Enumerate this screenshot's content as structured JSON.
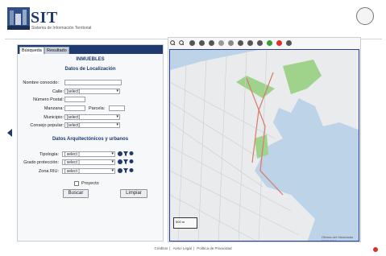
{
  "header": {
    "brand": "SIT",
    "subtitle": "Sistema de Información Territorial"
  },
  "tabs": [
    {
      "label": "Búsqueda"
    },
    {
      "label": "Resultado"
    }
  ],
  "panel": {
    "title": "INMUEBLES",
    "localization_title": "Datos de Localización",
    "architecture_title": "Datos Arquitectónicos y urbanos",
    "fields": {
      "nombre": {
        "label": "Nombre conocido:",
        "value": ""
      },
      "calle": {
        "label": "Calle:",
        "value": "[select]"
      },
      "numero": {
        "label": "Número Postal:",
        "value": ""
      },
      "manzana": {
        "label": "Manzana:",
        "value": ""
      },
      "parcela": {
        "label": "Parcela:",
        "value": ""
      },
      "municipio": {
        "label": "Municipio:",
        "value": "[select]"
      },
      "consejo": {
        "label": "Consejo popular:",
        "value": "[select]"
      },
      "tipologia": {
        "label": "Tipología:",
        "value": "[ select ]"
      },
      "grado": {
        "label": "Grado protección:",
        "value": "[ select ]"
      },
      "zona": {
        "label": "Zona RIU:",
        "value": "[ select ]"
      }
    },
    "checkbox_label": "Proyecto",
    "buttons": {
      "search": "Buscar",
      "clear": "Limpiar"
    }
  },
  "map": {
    "scale_label": "500 m",
    "credit": "Oficina del Historiador 2007-2011"
  },
  "footer": {
    "links": [
      "Créditos",
      "Aviso Legal",
      "Política de Privacidad"
    ]
  },
  "colors": {
    "accent": "#1e3a6e",
    "water": "#bcd3e8",
    "land": "#e9ebed",
    "park": "#9fd28a",
    "highlight": "#d8312e"
  },
  "icons": {
    "zoom_in": "zoom-in-icon",
    "zoom_out": "zoom-out-icon",
    "red_dot": "red-dot-icon"
  }
}
